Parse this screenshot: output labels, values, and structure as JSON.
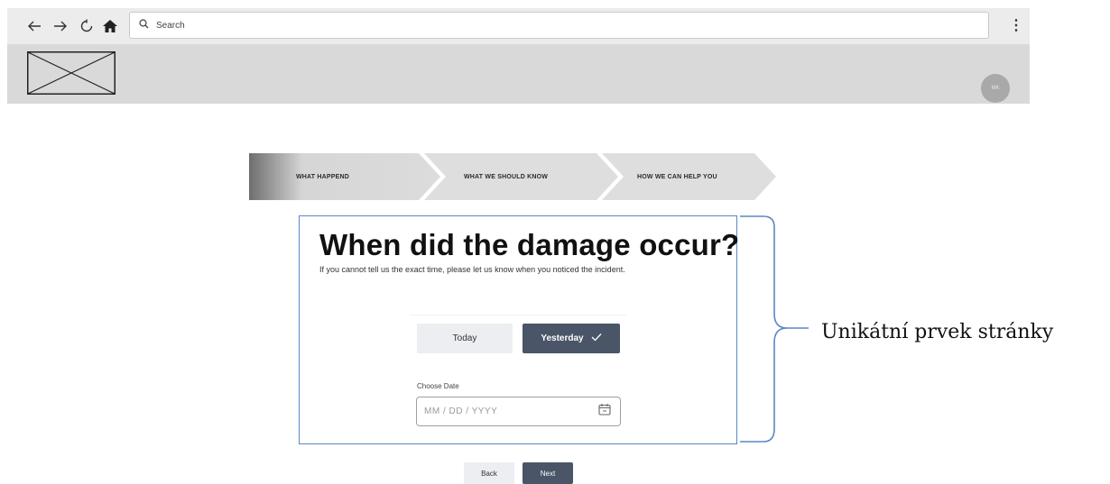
{
  "browser": {
    "search_placeholder": "Search",
    "icons": {
      "back": "arrow-left-icon",
      "forward": "arrow-right-icon",
      "reload": "reload-icon",
      "home": "home-icon",
      "search": "search-icon",
      "menu": "kebab-menu-icon"
    }
  },
  "header": {
    "avatar_initials": "MK"
  },
  "stepper": {
    "steps": [
      {
        "label": "WHAT HAPPEND",
        "active": true
      },
      {
        "label": "WHAT WE SHOULD KNOW",
        "active": false
      },
      {
        "label": "HOW WE CAN HELP YOU",
        "active": false
      }
    ]
  },
  "form": {
    "title": "When did the damage occur?",
    "subtitle": "If you cannot tell us the exact time, please let us know when you noticed the incident.",
    "today_label": "Today",
    "yesterday_label": "Yesterday",
    "yesterday_selected": true,
    "choose_date_label": "Choose Date",
    "date_placeholder": "MM / DD / YYYY"
  },
  "nav": {
    "back_label": "Back",
    "next_label": "Next"
  },
  "annotation": {
    "text": "Unikátní prvek stránky"
  },
  "colors": {
    "accent": "#4a5568",
    "card_border": "#5b87c5",
    "header_bg": "#d9d9d9"
  }
}
